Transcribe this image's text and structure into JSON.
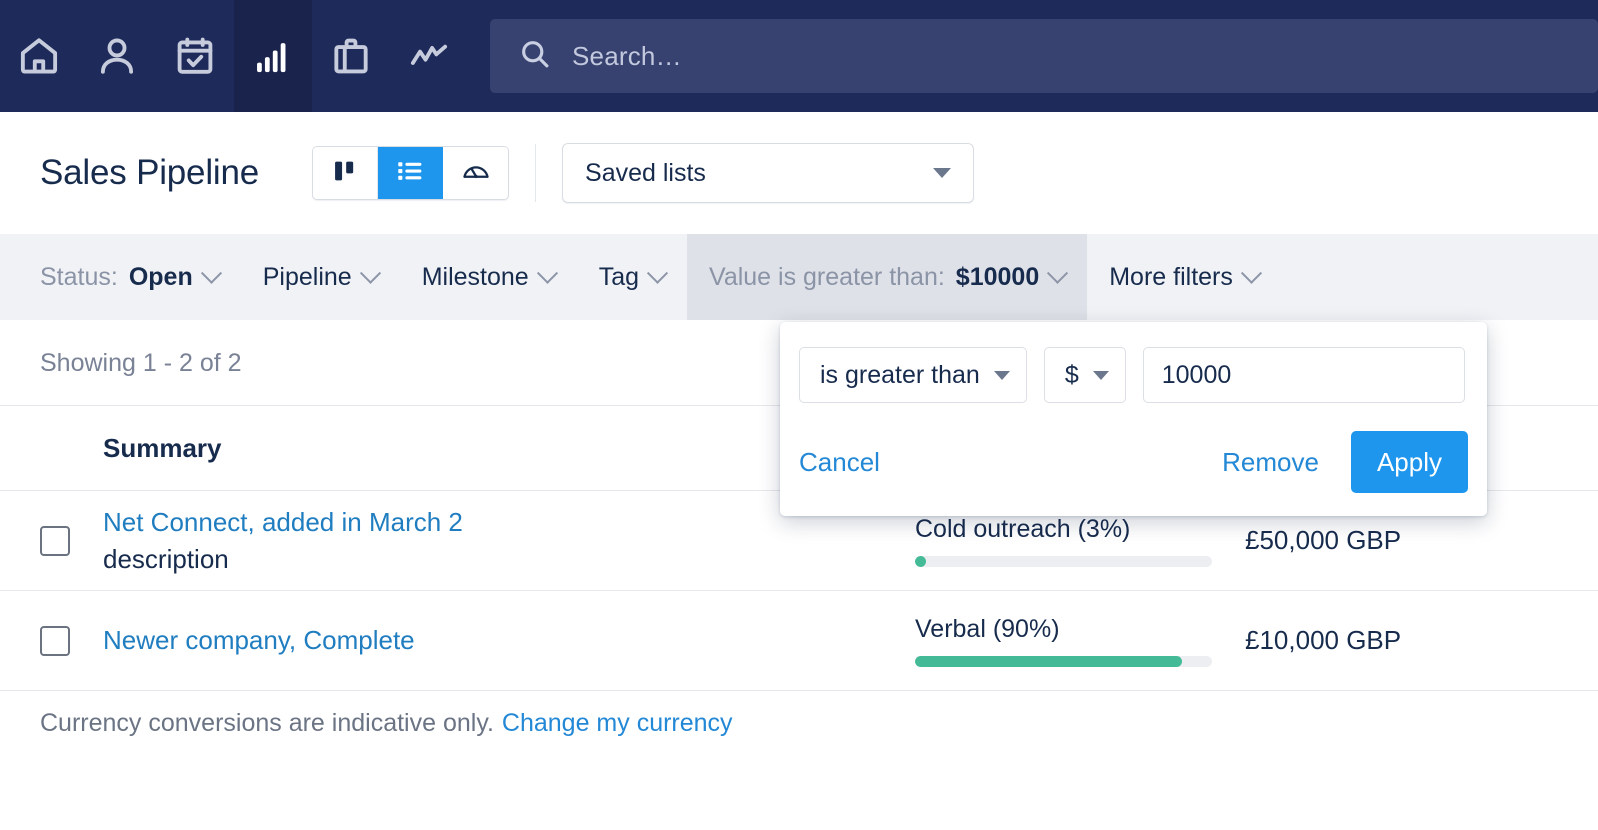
{
  "topnav": {
    "items": [
      {
        "icon": "home-icon",
        "name": "home",
        "active": false
      },
      {
        "icon": "person-icon",
        "name": "contacts",
        "active": false
      },
      {
        "icon": "calendar-check-icon",
        "name": "activities",
        "active": false
      },
      {
        "icon": "bar-chart-icon",
        "name": "pipeline",
        "active": true
      },
      {
        "icon": "briefcase-icon",
        "name": "projects",
        "active": false
      },
      {
        "icon": "trend-line-icon",
        "name": "reports",
        "active": false
      }
    ],
    "search": {
      "placeholder": "Search…",
      "value": "",
      "icon": "search-icon"
    },
    "background": "#1e2a5a",
    "active_background": "#19234c"
  },
  "header": {
    "title": "Sales Pipeline",
    "view_toggle": [
      {
        "name": "board-view",
        "icon": "board-icon",
        "active": false
      },
      {
        "name": "list-view",
        "icon": "list-icon",
        "active": true
      },
      {
        "name": "forecast-view",
        "icon": "gauge-icon",
        "active": false
      }
    ],
    "saved_lists": {
      "label": "Saved lists",
      "icon": "chevron-down-icon"
    }
  },
  "filter_bar": {
    "filters": [
      {
        "prefix": "Status:",
        "value": "Open",
        "active": false
      },
      {
        "prefix": "",
        "value": "Pipeline",
        "active": false
      },
      {
        "prefix": "",
        "value": "Milestone",
        "active": false
      },
      {
        "prefix": "",
        "value": "Tag",
        "active": false
      },
      {
        "prefix": "Value is greater than:",
        "value": "$10000",
        "active": true
      },
      {
        "prefix": "",
        "value": "More filters",
        "active": false
      }
    ]
  },
  "popover": {
    "operator": {
      "label": "is greater than",
      "icon": "caret-down-icon"
    },
    "currency": {
      "label": "$",
      "icon": "caret-down-icon"
    },
    "amount": {
      "value": "10000",
      "placeholder": ""
    },
    "cancel_label": "Cancel",
    "remove_label": "Remove",
    "apply_label": "Apply",
    "accent": "#1e96ee"
  },
  "results": {
    "showing": "Showing 1 - 2 of 2",
    "columns": {
      "summary": "Summary"
    },
    "rows": [
      {
        "checked": false,
        "link": "Net Connect, added in March 2",
        "description": "description",
        "milestone": "Cold outreach (3%)",
        "progress": 3,
        "value": "£50,000 GBP"
      },
      {
        "checked": false,
        "link": "Newer company, Complete",
        "description": "",
        "milestone": "Verbal (90%)",
        "progress": 90,
        "value": "£10,000 GBP"
      }
    ]
  },
  "footer": {
    "note": "Currency conversions are indicative only.",
    "link": "Change my currency"
  },
  "colors": {
    "nav": "#1e2a5a",
    "accent": "#1e96ee",
    "link": "#1f7dc0",
    "progress": "#44bb96",
    "filter_bar": "#f1f2f6",
    "filter_active": "#dfe1e8"
  }
}
